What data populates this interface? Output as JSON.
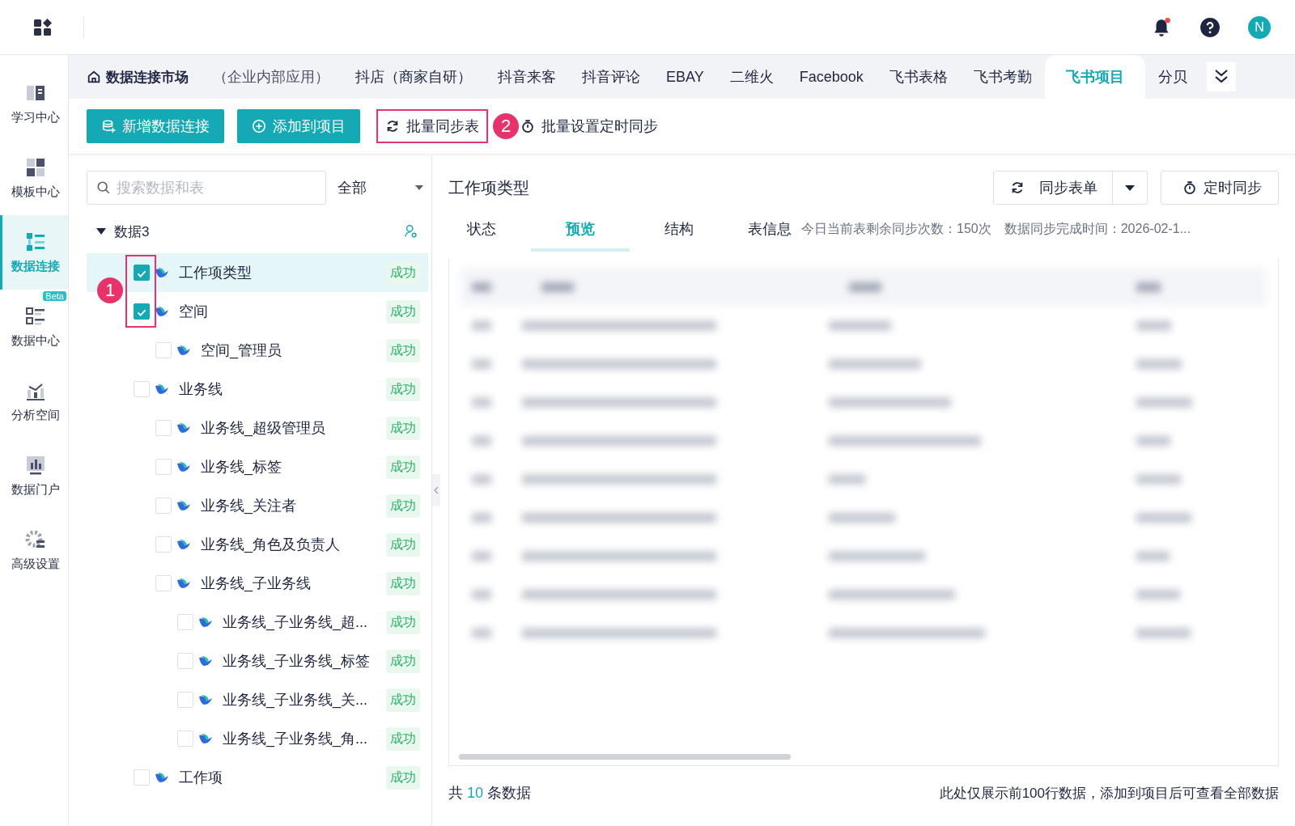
{
  "user": {
    "initial": "N"
  },
  "sidebar": {
    "items": [
      {
        "label": "学习中心",
        "selected": false
      },
      {
        "label": "模板中心",
        "selected": false
      },
      {
        "label": "数据连接",
        "selected": true
      },
      {
        "label": "数据中心",
        "selected": false,
        "badge": "Beta"
      },
      {
        "label": "分析空间",
        "selected": false
      },
      {
        "label": "数据门户",
        "selected": false
      },
      {
        "label": "高级设置",
        "selected": false
      }
    ]
  },
  "market_title": "数据连接市场",
  "tabs": [
    {
      "label": "（企业内部应用）",
      "selected": false
    },
    {
      "label": "抖店（商家自研）",
      "selected": false
    },
    {
      "label": "抖音来客",
      "selected": false
    },
    {
      "label": "抖音评论",
      "selected": false
    },
    {
      "label": "EBAY",
      "selected": false
    },
    {
      "label": "二维火",
      "selected": false
    },
    {
      "label": "Facebook",
      "selected": false
    },
    {
      "label": "飞书表格",
      "selected": false
    },
    {
      "label": "飞书考勤",
      "selected": false
    },
    {
      "label": "飞书项目",
      "selected": true
    },
    {
      "label": "分贝",
      "selected": false
    }
  ],
  "toolbar": {
    "buttons": [
      {
        "label": "新增数据连接",
        "kind": "primary"
      },
      {
        "label": "添加到项目",
        "kind": "primary"
      },
      {
        "label": "批量同步表",
        "kind": "outline",
        "annotation": "2"
      },
      {
        "label": "批量设置定时同步",
        "kind": "text"
      }
    ]
  },
  "search": {
    "placeholder": "搜索数据和表"
  },
  "filter": {
    "value": "全部"
  },
  "tree": {
    "label": "数据3",
    "expanded": true,
    "annotation": "1",
    "children": [
      {
        "label": "工作项类型",
        "checked": true,
        "selected": true,
        "status": "成功"
      },
      {
        "label": "空间",
        "checked": true,
        "selected": false,
        "status": "成功",
        "children": [
          {
            "label": "空间_管理员",
            "checked": false,
            "selected": false,
            "status": "成功"
          }
        ]
      },
      {
        "label": "业务线",
        "checked": false,
        "selected": false,
        "status": "成功",
        "children": [
          {
            "label": "业务线_超级管理员",
            "checked": false,
            "selected": false,
            "status": "成功"
          },
          {
            "label": "业务线_标签",
            "checked": false,
            "selected": false,
            "status": "成功"
          },
          {
            "label": "业务线_关注者",
            "checked": false,
            "selected": false,
            "status": "成功"
          },
          {
            "label": "业务线_角色及负责人",
            "checked": false,
            "selected": false,
            "status": "成功"
          },
          {
            "label": "业务线_子业务线",
            "checked": false,
            "selected": false,
            "status": "成功",
            "children": [
              {
                "label": "业务线_子业务线_超...",
                "checked": false,
                "selected": false,
                "status": "成功"
              },
              {
                "label": "业务线_子业务线_标签",
                "checked": false,
                "selected": false,
                "status": "成功"
              },
              {
                "label": "业务线_子业务线_关...",
                "checked": false,
                "selected": false,
                "status": "成功"
              },
              {
                "label": "业务线_子业务线_角...",
                "checked": false,
                "selected": false,
                "status": "成功"
              }
            ]
          }
        ]
      },
      {
        "label": "工作项",
        "checked": false,
        "selected": false,
        "status": "成功"
      }
    ]
  },
  "detail": {
    "title": "工作项类型",
    "sync_button": "同步表单",
    "schedule_button": "定时同步",
    "tabs": [
      {
        "label": "状态",
        "selected": false
      },
      {
        "label": "预览",
        "selected": true
      },
      {
        "label": "结构",
        "selected": false
      }
    ],
    "info_label": "表信息",
    "sync_count": "今日当前表剩余同步次数：150次",
    "sync_time": "数据同步完成时间：2026-02-1...",
    "footer": {
      "total_prefix": "共",
      "total_count": "10",
      "total_suffix": "条数据",
      "note": "此处仅展示前100行数据，添加到项目后可查看全部数据"
    }
  }
}
